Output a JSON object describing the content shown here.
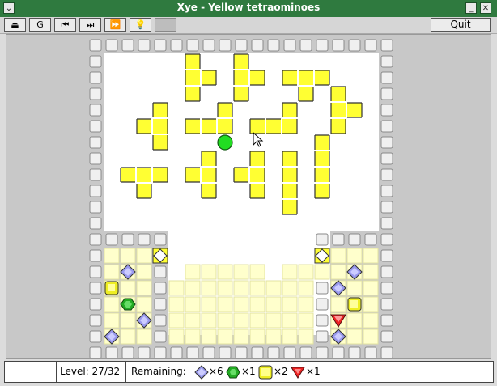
{
  "window": {
    "title": "Xye - Yellow tetraominoes",
    "menu_glyph": "⌄",
    "min_glyph": "_",
    "close_glyph": "✕"
  },
  "toolbar": {
    "buttons": [
      {
        "name": "eject-icon",
        "glyph": "⏏"
      },
      {
        "name": "restart-icon",
        "glyph": "G"
      },
      {
        "name": "first-level-icon",
        "glyph": "⏮"
      },
      {
        "name": "next-level-icon",
        "glyph": "⏭"
      },
      {
        "name": "fast-forward-icon",
        "glyph": "⏩"
      },
      {
        "name": "hint-icon",
        "glyph": "💡"
      },
      {
        "name": "blank-icon",
        "glyph": ""
      }
    ],
    "quit_label": "Quit"
  },
  "status": {
    "level_label": "Level: 27/32",
    "remaining_label": "Remaining:",
    "gems": [
      {
        "type": "blue",
        "count": "×6"
      },
      {
        "type": "green",
        "count": "×1"
      },
      {
        "type": "yellow",
        "count": "×2"
      },
      {
        "type": "red",
        "count": "×1"
      }
    ]
  },
  "colors": {
    "titlebar": "#2f7a3f",
    "piece_yellow": "#ffff33",
    "pad_yellow": "#ffffcc",
    "gem_blue": "#9999ee",
    "gem_green": "#22aa22",
    "gem_red": "#ee2222",
    "player_green": "#22dd22"
  }
}
